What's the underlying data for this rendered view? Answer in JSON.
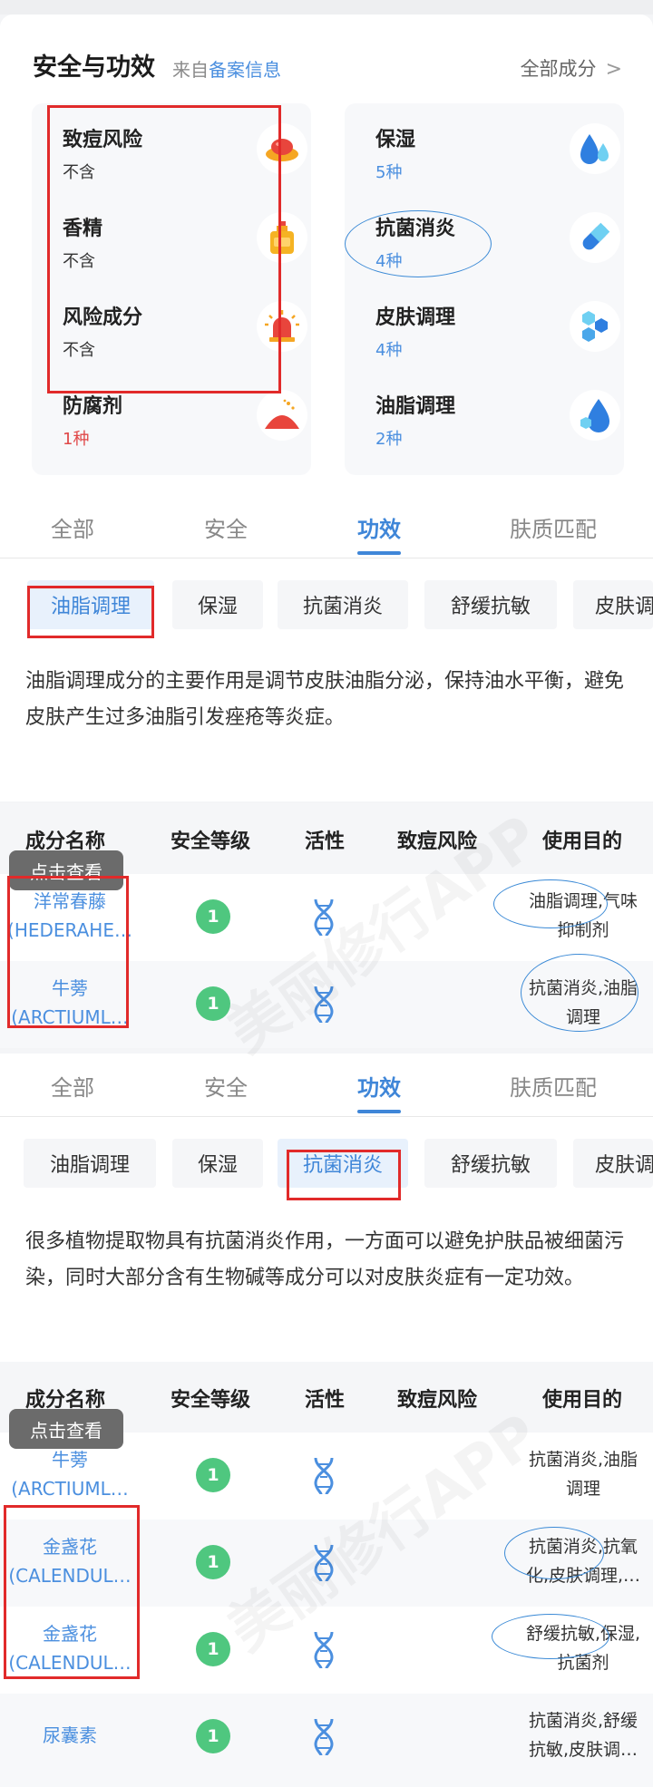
{
  "safety": {
    "title": "安全与功效",
    "source_prefix": "来自",
    "source_link": "备案信息",
    "all_ingredients": "全部成分",
    "left_items": [
      {
        "name": "致痘风险",
        "value": "不含"
      },
      {
        "name": "香精",
        "value": "不含"
      },
      {
        "name": "风险成分",
        "value": "不含"
      },
      {
        "name": "防腐剂",
        "value": "1种"
      }
    ],
    "right_items": [
      {
        "name": "保湿",
        "value": "5种"
      },
      {
        "name": "抗菌消炎",
        "value": "4种"
      },
      {
        "name": "皮肤调理",
        "value": "4种"
      },
      {
        "name": "油脂调理",
        "value": "2种"
      }
    ]
  },
  "tabs": [
    "全部",
    "安全",
    "功效",
    "肤质匹配"
  ],
  "chips": [
    "油脂调理",
    "保湿",
    "抗菌消炎",
    "舒缓抗敏",
    "皮肤调"
  ],
  "table_headers": [
    "成分名称",
    "安全等级",
    "活性",
    "致痘风险",
    "使用目的"
  ],
  "tooltip": "点击查看",
  "section1": {
    "description": "油脂调理成分的主要作用是调节皮肤油脂分泌，保持油水平衡，避免皮肤产生过多油脂引发痤疮等炎症。",
    "rows": [
      {
        "name": "洋常春藤",
        "latin": "(HEDERAHE…",
        "level": "1",
        "purpose1": "油脂调理,气味",
        "purpose2": "抑制剂"
      },
      {
        "name": "牛蒡",
        "latin": "(ARCTIUML…",
        "level": "1",
        "purpose1": "抗菌消炎,油脂",
        "purpose2": "调理"
      }
    ]
  },
  "section2": {
    "description": "很多植物提取物具有抗菌消炎作用，一方面可以避免护肤品被细菌污染，同时大部分含有生物碱等成分可以对皮肤炎症有一定功效。",
    "rows": [
      {
        "name": "牛蒡",
        "latin": "(ARCTIUML…",
        "level": "1",
        "purpose1": "抗菌消炎,油脂",
        "purpose2": "调理"
      },
      {
        "name": "金盏花",
        "latin": "(CALENDUL…",
        "level": "1",
        "purpose1": "抗菌消炎,抗氧",
        "purpose2": "化,皮肤调理,…"
      },
      {
        "name": "金盏花",
        "latin": "(CALENDUL…",
        "level": "1",
        "purpose1": "舒缓抗敏,保湿,",
        "purpose2": "抗菌剂"
      },
      {
        "name": "尿囊素",
        "latin": "",
        "level": "1",
        "purpose1": "抗菌消炎,舒缓",
        "purpose2": "抗敏,皮肤调…"
      }
    ]
  },
  "watermark": "美丽修行APP",
  "colors": {
    "accent": "#3f86d8",
    "safe": "#4fc77f",
    "annotation_red": "#e12a2a",
    "annotation_blue": "#3b8ad6"
  }
}
